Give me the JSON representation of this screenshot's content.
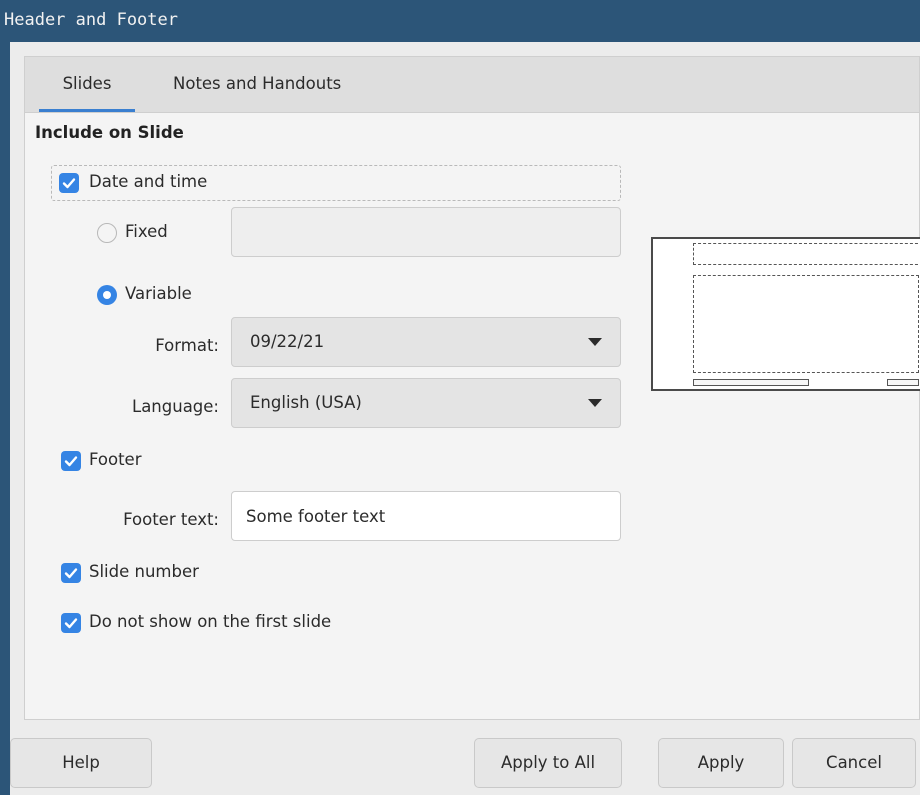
{
  "window": {
    "title": "Header and Footer"
  },
  "tabs": [
    {
      "label": "Slides",
      "active": true
    },
    {
      "label": "Notes and Handouts",
      "active": false
    }
  ],
  "section": {
    "title": "Include on Slide"
  },
  "date_time": {
    "label": "Date and time",
    "checked": true,
    "fixed": {
      "label": "Fixed",
      "selected": false,
      "value": ""
    },
    "variable": {
      "label": "Variable",
      "selected": true
    },
    "format": {
      "label": "Format:",
      "value": "09/22/21"
    },
    "language": {
      "label": "Language:",
      "value": "English (USA)"
    }
  },
  "footer": {
    "label": "Footer",
    "checked": true,
    "text_label": "Footer text:",
    "text_value": "Some footer text"
  },
  "slide_number": {
    "label": "Slide number",
    "checked": true
  },
  "not_first": {
    "label": "Do not show on the first slide",
    "checked": true
  },
  "buttons": {
    "help": "Help",
    "apply_all": "Apply to All",
    "apply": "Apply",
    "cancel": "Cancel"
  },
  "colors": {
    "title_bar": "#2c5578",
    "accent": "#3584e4"
  }
}
